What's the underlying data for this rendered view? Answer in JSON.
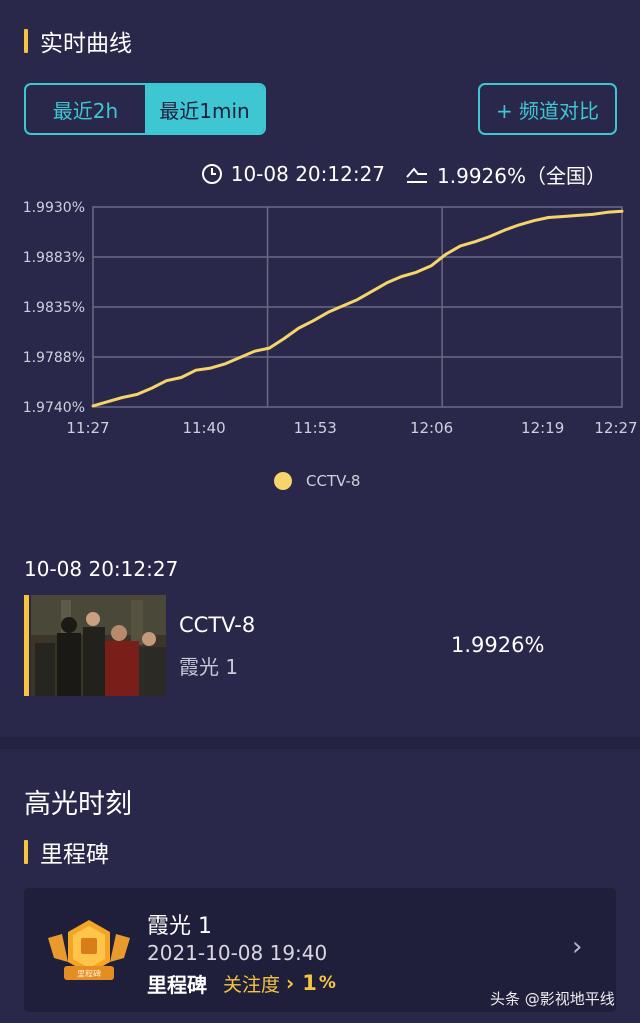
{
  "section": {
    "title": "实时曲线"
  },
  "segments": {
    "opt1": "最近2h",
    "opt2": "最近1min"
  },
  "compare_button": "+ 频道对比",
  "meta": {
    "time": "10-08 20:12:27",
    "rating": "1.9926%（全国）"
  },
  "colors": {
    "accent": "#f5c542",
    "teal": "#3ec6d3",
    "line": "#f7d46b",
    "background": "#29284a"
  },
  "chart_data": {
    "type": "line",
    "x_labels": [
      "11:27",
      "11:40",
      "11:53",
      "12:06",
      "12:19",
      "12:27"
    ],
    "y_ticks": [
      "1.9930%",
      "1.9883%",
      "1.9835%",
      "1.9788%",
      "1.9740%"
    ],
    "ylim": [
      1.974,
      1.993
    ],
    "grid": true,
    "legend_position": "bottom",
    "series": [
      {
        "name": "CCTV-8",
        "values": [
          1.9741,
          1.9745,
          1.9749,
          1.9752,
          1.9758,
          1.9765,
          1.9768,
          1.9775,
          1.9777,
          1.9781,
          1.9787,
          1.9793,
          1.9796,
          1.9805,
          1.9815,
          1.9822,
          1.983,
          1.9836,
          1.9842,
          1.985,
          1.9858,
          1.9864,
          1.9868,
          1.9874,
          1.9885,
          1.9893,
          1.9897,
          1.9902,
          1.9908,
          1.9913,
          1.9917,
          1.992,
          1.9921,
          1.9922,
          1.9923,
          1.9925,
          1.9926
        ]
      }
    ]
  },
  "legend_label": "CCTV-8",
  "timestamp": "10-08 20:12:27",
  "program": {
    "channel": "CCTV-8",
    "name": "霞光 1",
    "rating": "1.9926%"
  },
  "highlight": {
    "title": "高光时刻",
    "subtitle": "里程碑"
  },
  "milestone": {
    "name": "霞光 1",
    "date": "2021-10-08 19:40",
    "tag": "里程碑",
    "focus_label": "关注度",
    "value": "1",
    "unit": "%",
    "badge_text": "里程碑"
  },
  "watermark": "头条 @影视地平线"
}
